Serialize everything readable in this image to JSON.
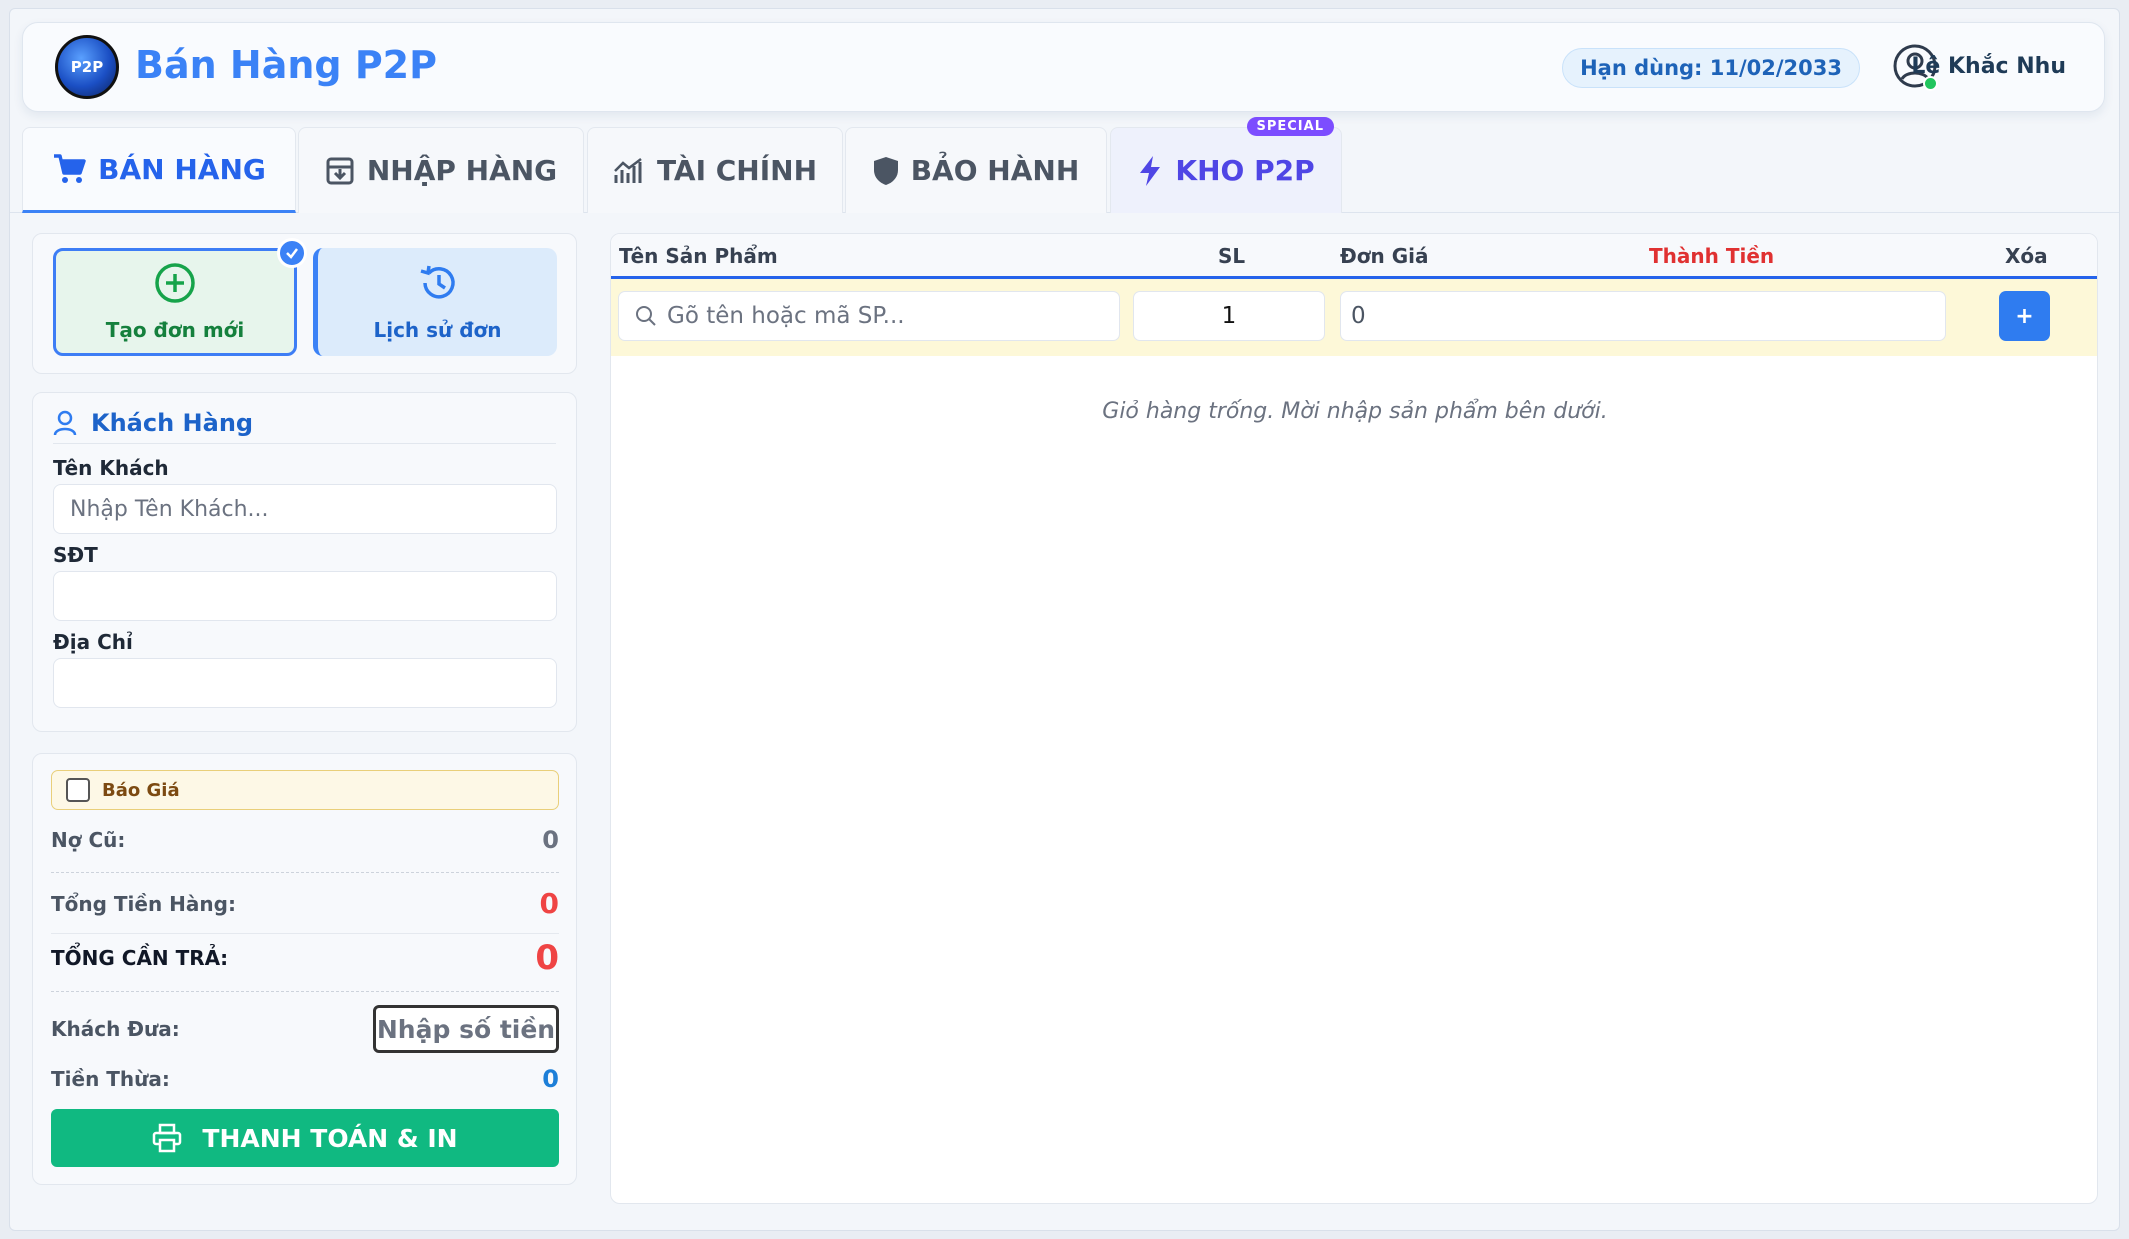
{
  "header": {
    "logo_text": "P2P",
    "title": "Bán Hàng P2P",
    "expiry": "Hạn dùng: 11/02/2033",
    "user_name": "Lê Khắc Nhu"
  },
  "tabs": [
    {
      "label": "BÁN HÀNG",
      "icon": "cart-icon",
      "active": true
    },
    {
      "label": "NHẬP HÀNG",
      "icon": "import-icon",
      "active": false
    },
    {
      "label": "TÀI CHÍNH",
      "icon": "chart-icon",
      "active": false
    },
    {
      "label": "BẢO HÀNH",
      "icon": "shield-icon",
      "active": false
    },
    {
      "label": "KHO P2P",
      "icon": "bolt-icon",
      "active": false,
      "badge": "SPECIAL"
    }
  ],
  "mode": {
    "new_order": "Tạo đơn mới",
    "history": "Lịch sử đơn"
  },
  "customer": {
    "section_title": "Khách Hàng",
    "name_label": "Tên Khách",
    "name_placeholder": "Nhập Tên Khách...",
    "phone_label": "SĐT",
    "phone_value": "",
    "address_label": "Địa Chỉ",
    "address_value": ""
  },
  "summary": {
    "quote_label": "Báo Giá",
    "quote_checked": false,
    "old_debt_label": "Nợ Cũ:",
    "old_debt_value": "0",
    "subtotal_label": "Tổng Tiền Hàng:",
    "subtotal_value": "0",
    "total_label": "TỔNG CẦN TRẢ:",
    "total_value": "0",
    "paid_label": "Khách Đưa:",
    "paid_placeholder": "Nhập số tiền",
    "change_label": "Tiền Thừa:",
    "change_value": "0",
    "pay_button": "THANH TOÁN & IN"
  },
  "cart": {
    "columns": {
      "product": "Tên Sản Phẩm",
      "qty": "SL",
      "price": "Đơn Giá",
      "amount": "Thành Tiền",
      "delete": "Xóa"
    },
    "search_placeholder": "Gõ tên hoặc mã SP...",
    "qty_value": "1",
    "price_value": "0",
    "add_button": "+",
    "empty_message": "Giỏ hàng trống. Mời nhập sản phẩm bên dưới."
  },
  "colors": {
    "accent": "#3b82f6",
    "success": "#10b981",
    "danger": "#ef4444",
    "special": "#7c4dff"
  }
}
